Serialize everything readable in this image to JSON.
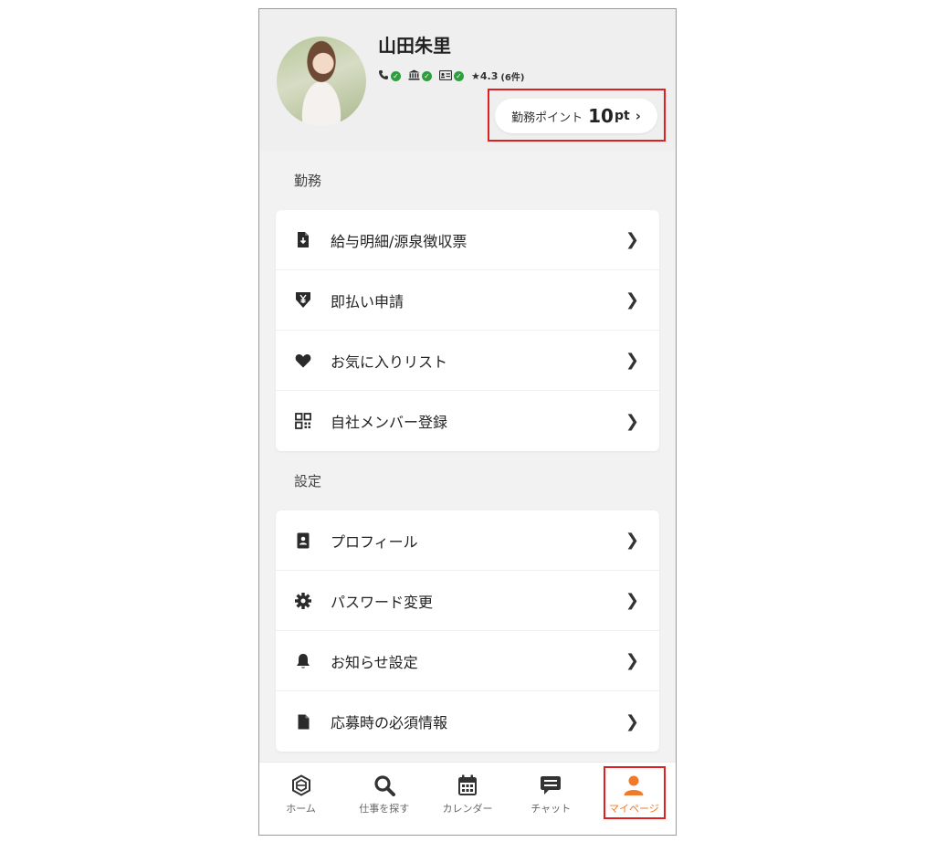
{
  "profile": {
    "name": "山田朱里",
    "badges": [
      {
        "icon": "phone-icon"
      },
      {
        "icon": "bank-icon"
      },
      {
        "icon": "id-card-icon"
      }
    ],
    "rating": "★4.3",
    "rating_count": "(6件)",
    "point_label": "勤務ポイント",
    "point_value": "10",
    "point_unit": "pt"
  },
  "sections": {
    "work": {
      "title": "勤務",
      "items": [
        {
          "label": "給与明細/源泉徴収票",
          "icon": "document-download-icon"
        },
        {
          "label": "即払い申請",
          "icon": "yen-arrow-icon"
        },
        {
          "label": "お気に入りリスト",
          "icon": "heart-icon"
        },
        {
          "label": "自社メンバー登録",
          "icon": "qr-code-icon"
        }
      ]
    },
    "settings": {
      "title": "設定",
      "items": [
        {
          "label": "プロフィール",
          "icon": "profile-card-icon"
        },
        {
          "label": "パスワード変更",
          "icon": "gear-icon"
        },
        {
          "label": "お知らせ設定",
          "icon": "bell-icon"
        },
        {
          "label": "応募時の必須情報",
          "icon": "file-icon"
        }
      ]
    }
  },
  "nav": {
    "items": [
      {
        "label": "ホーム",
        "icon": "home-hex-icon"
      },
      {
        "label": "仕事を探す",
        "icon": "search-icon"
      },
      {
        "label": "カレンダー",
        "icon": "calendar-icon"
      },
      {
        "label": "チャット",
        "icon": "chat-icon"
      },
      {
        "label": "マイページ",
        "icon": "user-icon",
        "active": true
      }
    ]
  },
  "colors": {
    "accent": "#f07a2a",
    "verified": "#2e9e3e",
    "highlight": "#e02020"
  }
}
